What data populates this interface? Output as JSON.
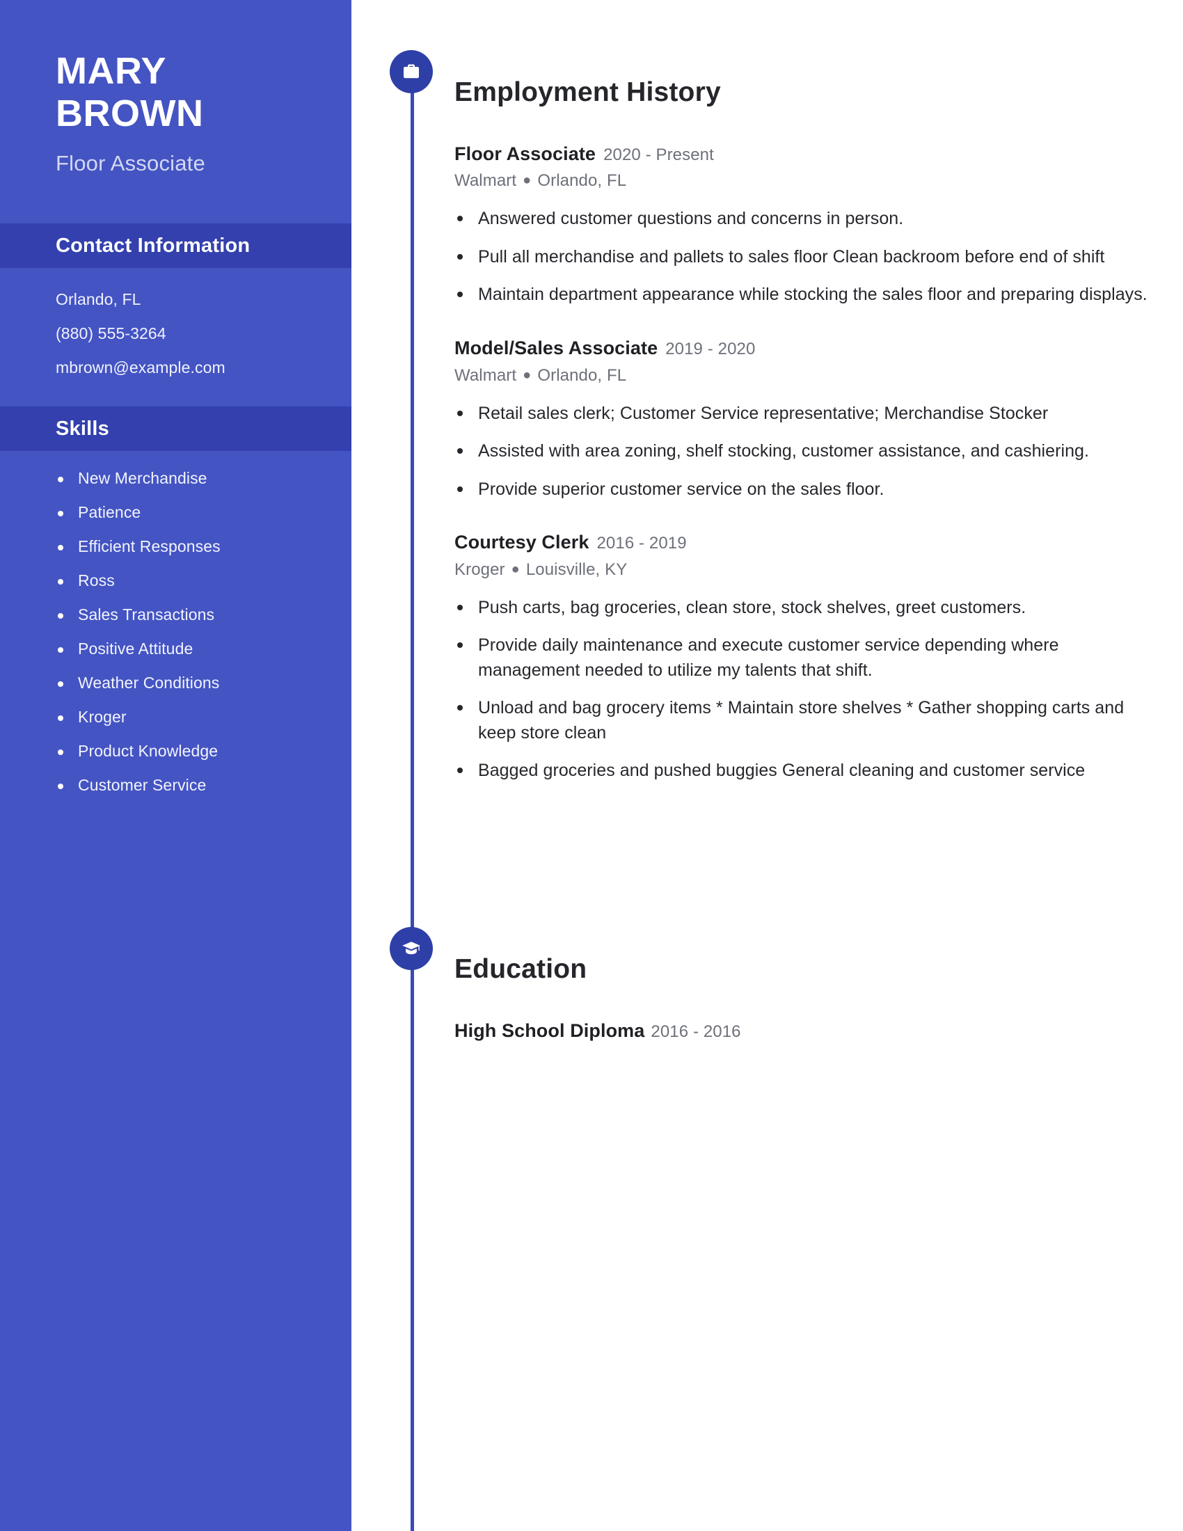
{
  "theme": {
    "sidebar_bg": "#4454c3",
    "sidebar_header_bg": "#3340ad",
    "timeline_color": "#3a4ab8",
    "icon_circle_bg": "#2e3fa8",
    "page_bg": "#ffffff",
    "body_text": "#26272c",
    "muted_text": "#6e707a"
  },
  "sidebar": {
    "name_first": "MARY",
    "name_last": "BROWN",
    "job_title": "Floor Associate",
    "contact": {
      "heading": "Contact Information",
      "lines": [
        "Orlando, FL",
        "(880) 555-3264",
        "mbrown@example.com"
      ]
    },
    "skills": {
      "heading": "Skills",
      "items": [
        "New Merchandise",
        "Patience",
        "Efficient Responses",
        "Ross",
        "Sales Transactions",
        "Positive Attitude",
        "Weather Conditions",
        "Kroger",
        "Product Knowledge",
        "Customer Service"
      ]
    }
  },
  "employment": {
    "heading": "Employment History",
    "icon": "briefcase-icon",
    "jobs": [
      {
        "role": "Floor Associate",
        "dates": "2020 - Present",
        "company": "Walmart",
        "location": "Orlando, FL",
        "bullets": [
          "Answered customer questions and concerns in person.",
          "Pull all merchandise and pallets to sales floor Clean backroom before end of shift",
          "Maintain department appearance while stocking the sales floor and preparing displays."
        ]
      },
      {
        "role": "Model/Sales Associate",
        "dates": "2019 - 2020",
        "company": "Walmart",
        "location": "Orlando, FL",
        "bullets": [
          "Retail sales clerk; Customer Service representative; Merchandise Stocker",
          "Assisted with area zoning, shelf stocking, customer assistance, and cashiering.",
          "Provide superior customer service on the sales floor."
        ]
      },
      {
        "role": "Courtesy Clerk",
        "dates": "2016 - 2019",
        "company": "Kroger",
        "location": "Louisville, KY",
        "bullets": [
          "Push carts, bag groceries, clean store, stock shelves, greet customers.",
          "Provide daily maintenance and execute customer service depending where management needed to utilize my talents that shift.",
          "Unload and bag grocery items * Maintain store shelves * Gather shopping carts and keep store clean",
          "Bagged groceries and pushed buggies General cleaning and customer service"
        ]
      }
    ]
  },
  "education": {
    "heading": "Education",
    "icon": "graduation-cap-icon",
    "entries": [
      {
        "degree": "High School Diploma",
        "dates": "2016 - 2016"
      }
    ]
  }
}
